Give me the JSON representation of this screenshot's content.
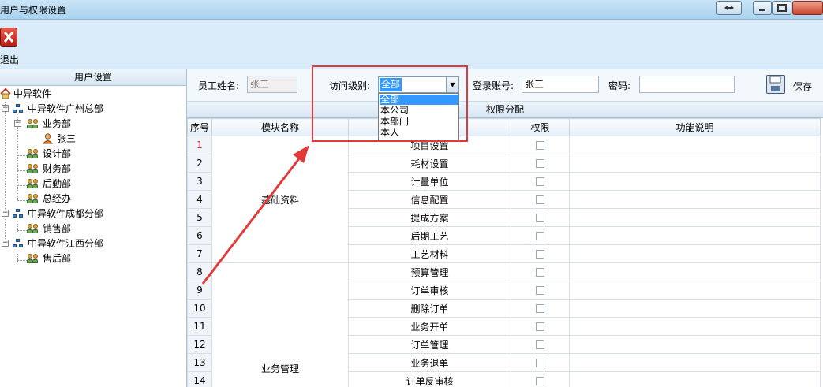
{
  "window": {
    "title": "用户与权限设置"
  },
  "toolbar": {
    "exit_label": "退出"
  },
  "left_panel": {
    "header": "用户设置",
    "tree": [
      {
        "label": "中异软件",
        "icon": "home-icon"
      },
      {
        "label": "中异软件广州总部",
        "icon": "org-icon"
      },
      {
        "label": "业务部",
        "icon": "dept-icon"
      },
      {
        "label": "张三",
        "icon": "user-icon"
      },
      {
        "label": "设计部",
        "icon": "dept-icon"
      },
      {
        "label": "财务部",
        "icon": "dept-icon"
      },
      {
        "label": "后勤部",
        "icon": "dept-icon"
      },
      {
        "label": "总经办",
        "icon": "dept-icon"
      },
      {
        "label": "中异软件成都分部",
        "icon": "org-icon"
      },
      {
        "label": "销售部",
        "icon": "dept-icon"
      },
      {
        "label": "中异软件江西分部",
        "icon": "org-icon"
      },
      {
        "label": "售后部",
        "icon": "dept-icon"
      }
    ]
  },
  "form": {
    "name_label": "员工姓名:",
    "name_value": "张三",
    "access_label": "访问级别:",
    "access_selected": "全部",
    "access_options": [
      "全部",
      "本公司",
      "本部门",
      "本人"
    ],
    "account_label": "登录账号:",
    "account_value": "张三",
    "password_label": "密码:",
    "password_value": "",
    "save_label": "保存"
  },
  "grid": {
    "title": "权限分配",
    "columns": [
      "序号",
      "模块名称",
      "",
      "权限",
      "功能说明"
    ],
    "modules": [
      "基础资料",
      "业务管理"
    ],
    "rows": [
      {
        "idx": "1",
        "func": "项目设置"
      },
      {
        "idx": "2",
        "func": "耗材设置"
      },
      {
        "idx": "3",
        "func": "计量单位"
      },
      {
        "idx": "4",
        "func": "信息配置"
      },
      {
        "idx": "5",
        "func": "提成方案"
      },
      {
        "idx": "6",
        "func": "后期工艺"
      },
      {
        "idx": "7",
        "func": "工艺材料"
      },
      {
        "idx": "8",
        "func": "预算管理"
      },
      {
        "idx": "9",
        "func": "订单审核"
      },
      {
        "idx": "10",
        "func": "删除订单"
      },
      {
        "idx": "11",
        "func": "业务开单"
      },
      {
        "idx": "12",
        "func": "订单管理"
      },
      {
        "idx": "13",
        "func": "业务退单"
      },
      {
        "idx": "14",
        "func": "订单反审核"
      }
    ]
  },
  "colors": {
    "annotation": "#e23a3a",
    "selection": "#3399ff"
  }
}
